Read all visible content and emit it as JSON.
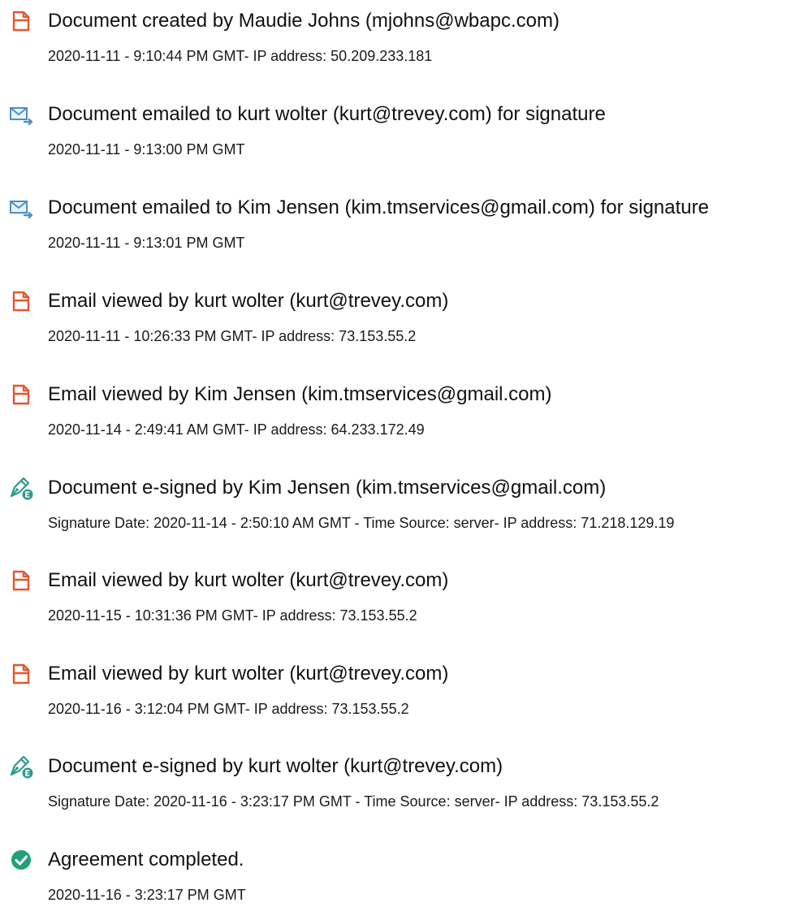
{
  "colors": {
    "document_icon": "#e4572e",
    "email_icon": "#4a90c8",
    "esign_icon": "#2e9a8a",
    "complete_icon": "#21a179"
  },
  "events": [
    {
      "icon": "document-icon",
      "title": "Document created by Maudie Johns (mjohns@wbapc.com)",
      "detail": "2020-11-11 - 9:10:44 PM GMT- IP address: 50.209.233.181"
    },
    {
      "icon": "email-sent-icon",
      "title": "Document emailed to kurt wolter (kurt@trevey.com) for signature",
      "detail": "2020-11-11 - 9:13:00 PM GMT"
    },
    {
      "icon": "email-sent-icon",
      "title": "Document emailed to Kim Jensen (kim.tmservices@gmail.com) for signature",
      "detail": "2020-11-11 - 9:13:01 PM GMT"
    },
    {
      "icon": "document-icon",
      "title": "Email viewed by kurt wolter (kurt@trevey.com)",
      "detail": "2020-11-11 - 10:26:33 PM GMT- IP address: 73.153.55.2"
    },
    {
      "icon": "document-icon",
      "title": "Email viewed by Kim Jensen (kim.tmservices@gmail.com)",
      "detail": "2020-11-14 - 2:49:41 AM GMT- IP address: 64.233.172.49"
    },
    {
      "icon": "esign-pen-icon",
      "title": "Document e-signed by Kim Jensen (kim.tmservices@gmail.com)",
      "detail": "Signature Date: 2020-11-14 - 2:50:10 AM GMT - Time Source: server- IP address: 71.218.129.19"
    },
    {
      "icon": "document-icon",
      "title": "Email viewed by kurt wolter (kurt@trevey.com)",
      "detail": "2020-11-15 - 10:31:36 PM GMT- IP address: 73.153.55.2"
    },
    {
      "icon": "document-icon",
      "title": "Email viewed by kurt wolter (kurt@trevey.com)",
      "detail": "2020-11-16 - 3:12:04 PM GMT- IP address: 73.153.55.2"
    },
    {
      "icon": "esign-pen-icon",
      "title": "Document e-signed by kurt wolter (kurt@trevey.com)",
      "detail": "Signature Date: 2020-11-16 - 3:23:17 PM GMT - Time Source: server- IP address: 73.153.55.2"
    },
    {
      "icon": "checkmark-circle-icon",
      "title": "Agreement completed.",
      "detail": "2020-11-16 - 3:23:17 PM GMT"
    }
  ]
}
